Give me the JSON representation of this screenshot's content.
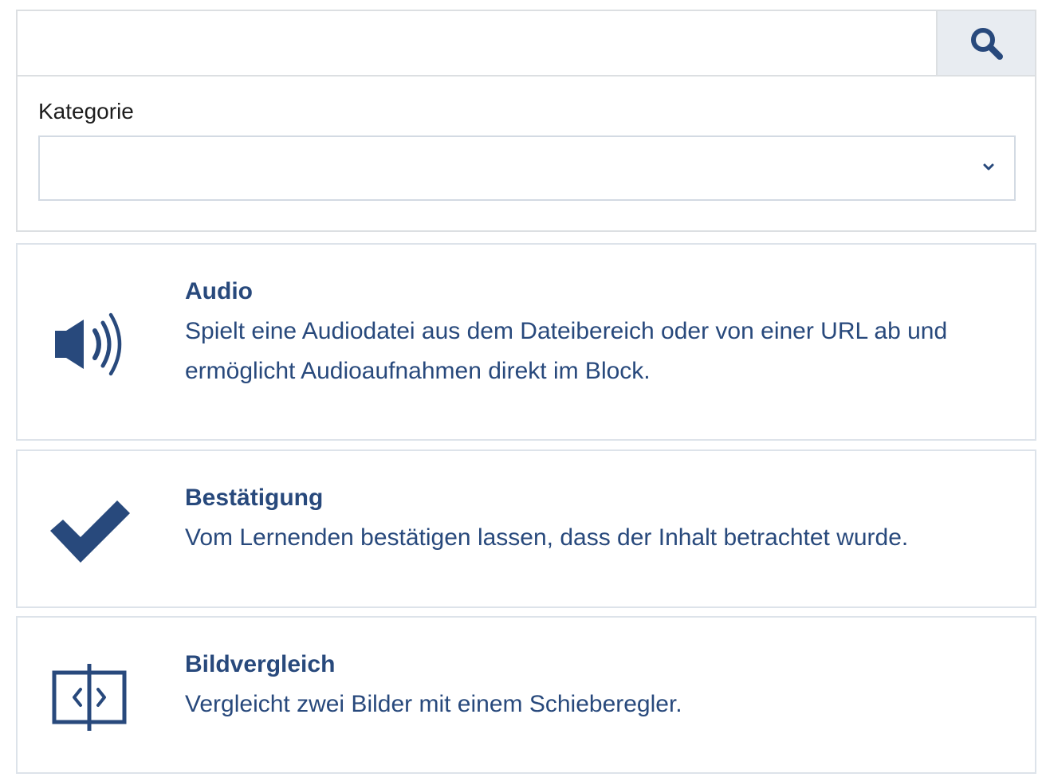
{
  "search": {
    "value": "",
    "placeholder": "",
    "button_icon": "search-icon"
  },
  "category": {
    "label": "Kategorie",
    "selected": "",
    "icon": "chevron-down-icon"
  },
  "colors": {
    "accent": "#28497c",
    "border": "#dcdfe2",
    "search_button_bg": "#e8ecf1"
  },
  "blocks": [
    {
      "icon": "speaker-icon",
      "title": "Audio",
      "description": "Spielt eine Audiodatei aus dem Dateibereich oder von einer URL ab und ermöglicht Audioaufnahmen direkt im Block."
    },
    {
      "icon": "checkmark-icon",
      "title": "Bestätigung",
      "description": "Vom Lernenden bestätigen lassen, dass der Inhalt betrachtet wurde."
    },
    {
      "icon": "image-compare-icon",
      "title": "Bildvergleich",
      "description": "Vergleicht zwei Bilder mit einem Schieberegler."
    }
  ]
}
